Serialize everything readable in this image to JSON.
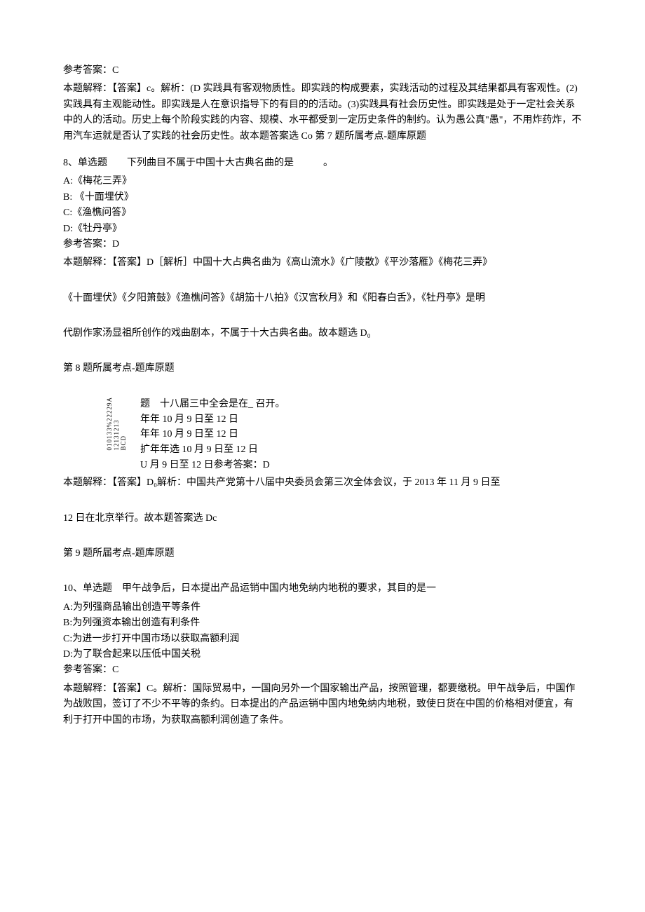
{
  "q7": {
    "answer_label": "参考答案：C",
    "explain": "本题解释：【答案】c。解析：(D 实践具有客观物质性。即实践的构成要素，实践活动的过程及其结果都具有客观性。(2)实践具有主观能动性。即实践是人在意识指导下的有目的的活动。(3)实践具有社会历史性。即实践是处于一定社会关系中的人的活动。历史上每个阶段实践的内容、规模、水平都受到一定历史条件的制约。认为愚公真\"愚\"，不用炸药炸，不用汽车运就是否认了实践的社会历史性。故本题答案选 Co 第 7 题所属考点-题库原题"
  },
  "q8": {
    "stem": "8、单选题　　下列曲目不属于中国十大古典名曲的是　　　。",
    "optA": "A:《梅花三弄》",
    "optB": "B: 《十面埋伏》",
    "optC": "C:《渔樵问答》",
    "optD": "D:《牡丹亭》",
    "answer_label": "参考答案：D",
    "explain1": "本题解释：【答案】D［解析］中国十大占典名曲为《高山流水》《广陵散》《平沙落雁》《梅花三弄》",
    "explain2": "《十面埋伏》《夕阳箫鼓》《渔樵问答》《胡笳十八拍》《汉宫秋月》和《阳春白舌》，《牡丹亭》是明",
    "explain3": "代剧作家汤显祖所创作的戏曲剧本，不属于十大古典名曲。故本题选 D₀",
    "footer": "第 8 题所属考点-题库原题"
  },
  "q9": {
    "vert1": "010133%22229A",
    "vert2": "12131213",
    "vert3": "BCD",
    "stem_right": "题　十八届三中全会是在_ 召开。",
    "line1": "年年 10 月 9 日至 12 日",
    "line2": "年年 10 月 9 日至 12 日",
    "line3": "扩年年选 10 月 9 日至 12 日",
    "line4": "U 月 9 日至 12 日参考答案：D",
    "explain1": "本题解释：【答案】D₀解析：中国共产党第十八届中央委员会第三次全体会议，于 2013 年 11 月 9 日至",
    "explain2": "12 日在北京举行。故本题答案选 Dc",
    "footer": "第 9 题所届考点-题库原题"
  },
  "q10": {
    "stem": "10、单选题　甲午战争后，日本提出产品运销中国内地免纳内地税的要求，其目的是一",
    "optA": "A:为列强商品输出创造平等条件",
    "optB": "B:为列强资本输出创造有利条件",
    "optC": "C:为进一步打开中国市场以获取高额利润",
    "optD": "D:为了联合起来以压低中国关税",
    "answer_label": "参考答案：C",
    "explain": "本题解释：【答案】C。解析：国际贸易中，一国向另外一个国家输出产品，按照管理，都要缴税。甲午战争后，中国作为战败国，签订了不少不平等的条约。日本提出的产品运销中国内地免纳内地税，致使日货在中国的价格相对便宜，有利于打开中国的市场，为获取高额利润创造了条件。"
  }
}
